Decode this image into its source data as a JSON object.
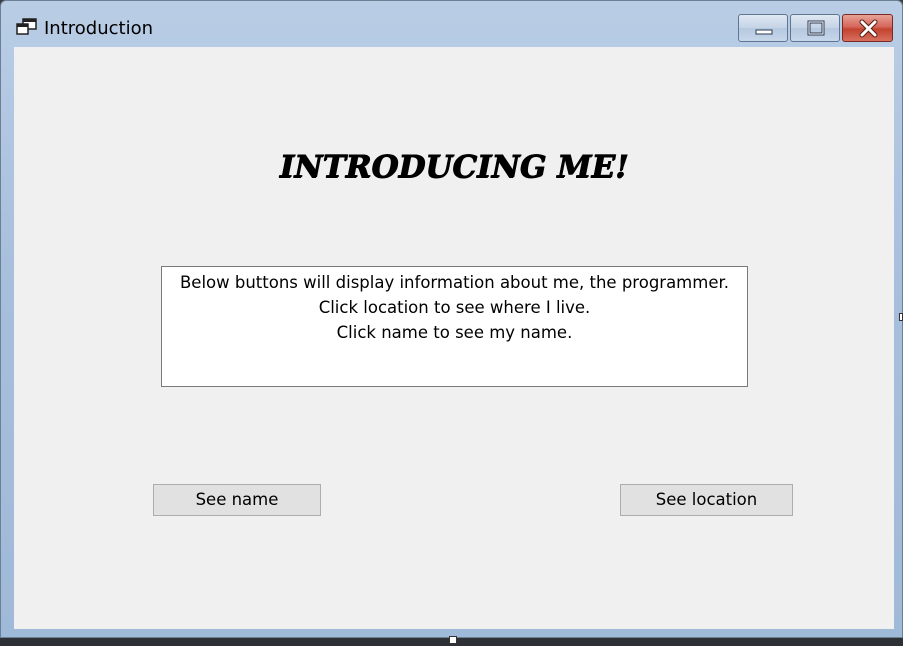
{
  "window": {
    "title": "Introduction",
    "app_icon": "windows-form-icon",
    "controls": {
      "minimize_icon": "minimize-icon",
      "maximize_icon": "maximize-icon",
      "close_icon": "close-icon"
    }
  },
  "form": {
    "heading": "INTRODUCING ME!",
    "info_lines": [
      "Below buttons will display information about me, the programmer.",
      "Click location to see where I live.",
      "Click name to see my name."
    ],
    "see_name_label": "See name",
    "see_location_label": "See location"
  },
  "colors": {
    "titlebar": "#a6bfdc",
    "client_background": "#f0f0f0",
    "button_face": "#e1e1e1",
    "close_button": "#c2432f"
  }
}
